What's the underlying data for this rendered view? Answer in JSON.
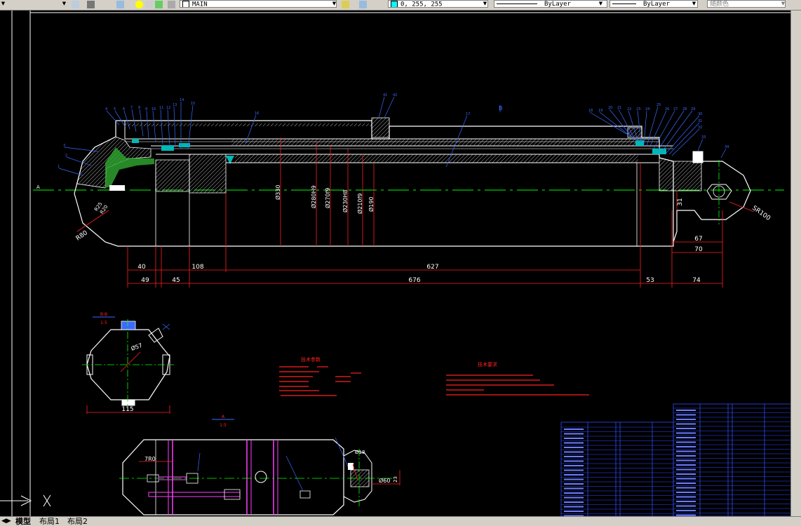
{
  "toolbar": {
    "layer_name": "MAIN",
    "color_value": "0, 255, 255",
    "linetype": "ByLayer",
    "lineweight": "ByLayer",
    "plotstyle": "随颜色"
  },
  "tabs": [
    "模型",
    "布局1",
    "布局2"
  ],
  "drawing": {
    "main_view": {
      "diameters": [
        "Ø330",
        "Ø280H9",
        "Ø270f9",
        "Ø230H8",
        "Ø210f9",
        "Ø190"
      ],
      "horiz_dims_row1": [
        "40",
        "108",
        "627"
      ],
      "horiz_dims_row2": [
        "49",
        "45",
        "676",
        "53",
        "74"
      ],
      "right_dims": [
        "67",
        "70"
      ],
      "vert_dim": "31",
      "radius_labels": [
        "R80",
        "R25",
        "R20"
      ],
      "sphere_label": "SR100"
    },
    "section_view": {
      "title": "B-B",
      "scale": "1:5",
      "width_dim": "115",
      "diam_label": "Ø57"
    },
    "top_view": {
      "title": "A",
      "scale": "1:5",
      "angle_label": "7R0",
      "right_diam": "Ø60",
      "pin_diam": "Ø18",
      "small_dim": "23"
    },
    "notes": {
      "title1": "技术参数",
      "title2": "技术要求"
    }
  },
  "colors": {
    "background": "#000000",
    "outline": "#ffffff",
    "dimension": "#ff2020",
    "centerline": "#00ff00",
    "leader": "#3a6bff",
    "title_block": "#2f4bff",
    "hatch": "#00b8b8",
    "magenta": "#ff40ff"
  }
}
